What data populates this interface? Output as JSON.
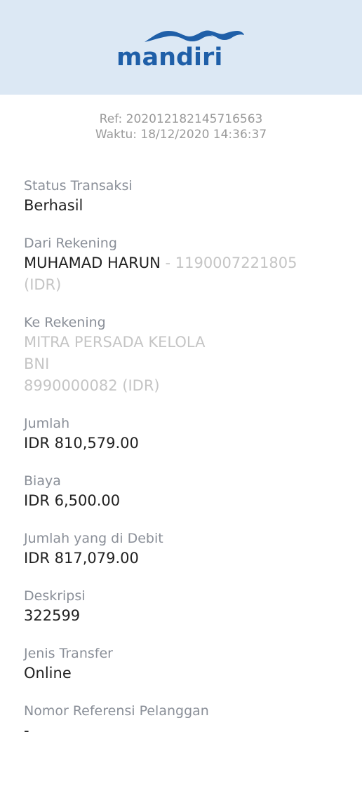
{
  "header": {
    "logo_text": "mandiri",
    "brand_color": "#1f5fa8",
    "background": "#dce8f4"
  },
  "meta": {
    "ref": "Ref: 202012182145716563",
    "time": "Waktu: 18/12/2020 14:36:37"
  },
  "fields": {
    "status": {
      "label": "Status Transaksi",
      "value": "Berhasil"
    },
    "from_account": {
      "label": "Dari Rekening",
      "name": "MUHAMAD HARUN",
      "number": " - 1190007221805",
      "currency": "(IDR)"
    },
    "to_account": {
      "label": "Ke Rekening",
      "name": "MITRA PERSADA KELOLA",
      "bank": "BNI",
      "number": "8990000082 (IDR)"
    },
    "amount": {
      "label": "Jumlah",
      "value": "IDR 810,579.00"
    },
    "fee": {
      "label": "Biaya",
      "value": "IDR 6,500.00"
    },
    "debited": {
      "label": "Jumlah yang di Debit",
      "value": "IDR 817,079.00"
    },
    "description": {
      "label": "Deskripsi",
      "value": "322599"
    },
    "transfer_type": {
      "label": "Jenis Transfer",
      "value": "Online"
    },
    "customer_ref": {
      "label": "Nomor Referensi Pelanggan",
      "value": "-"
    }
  }
}
